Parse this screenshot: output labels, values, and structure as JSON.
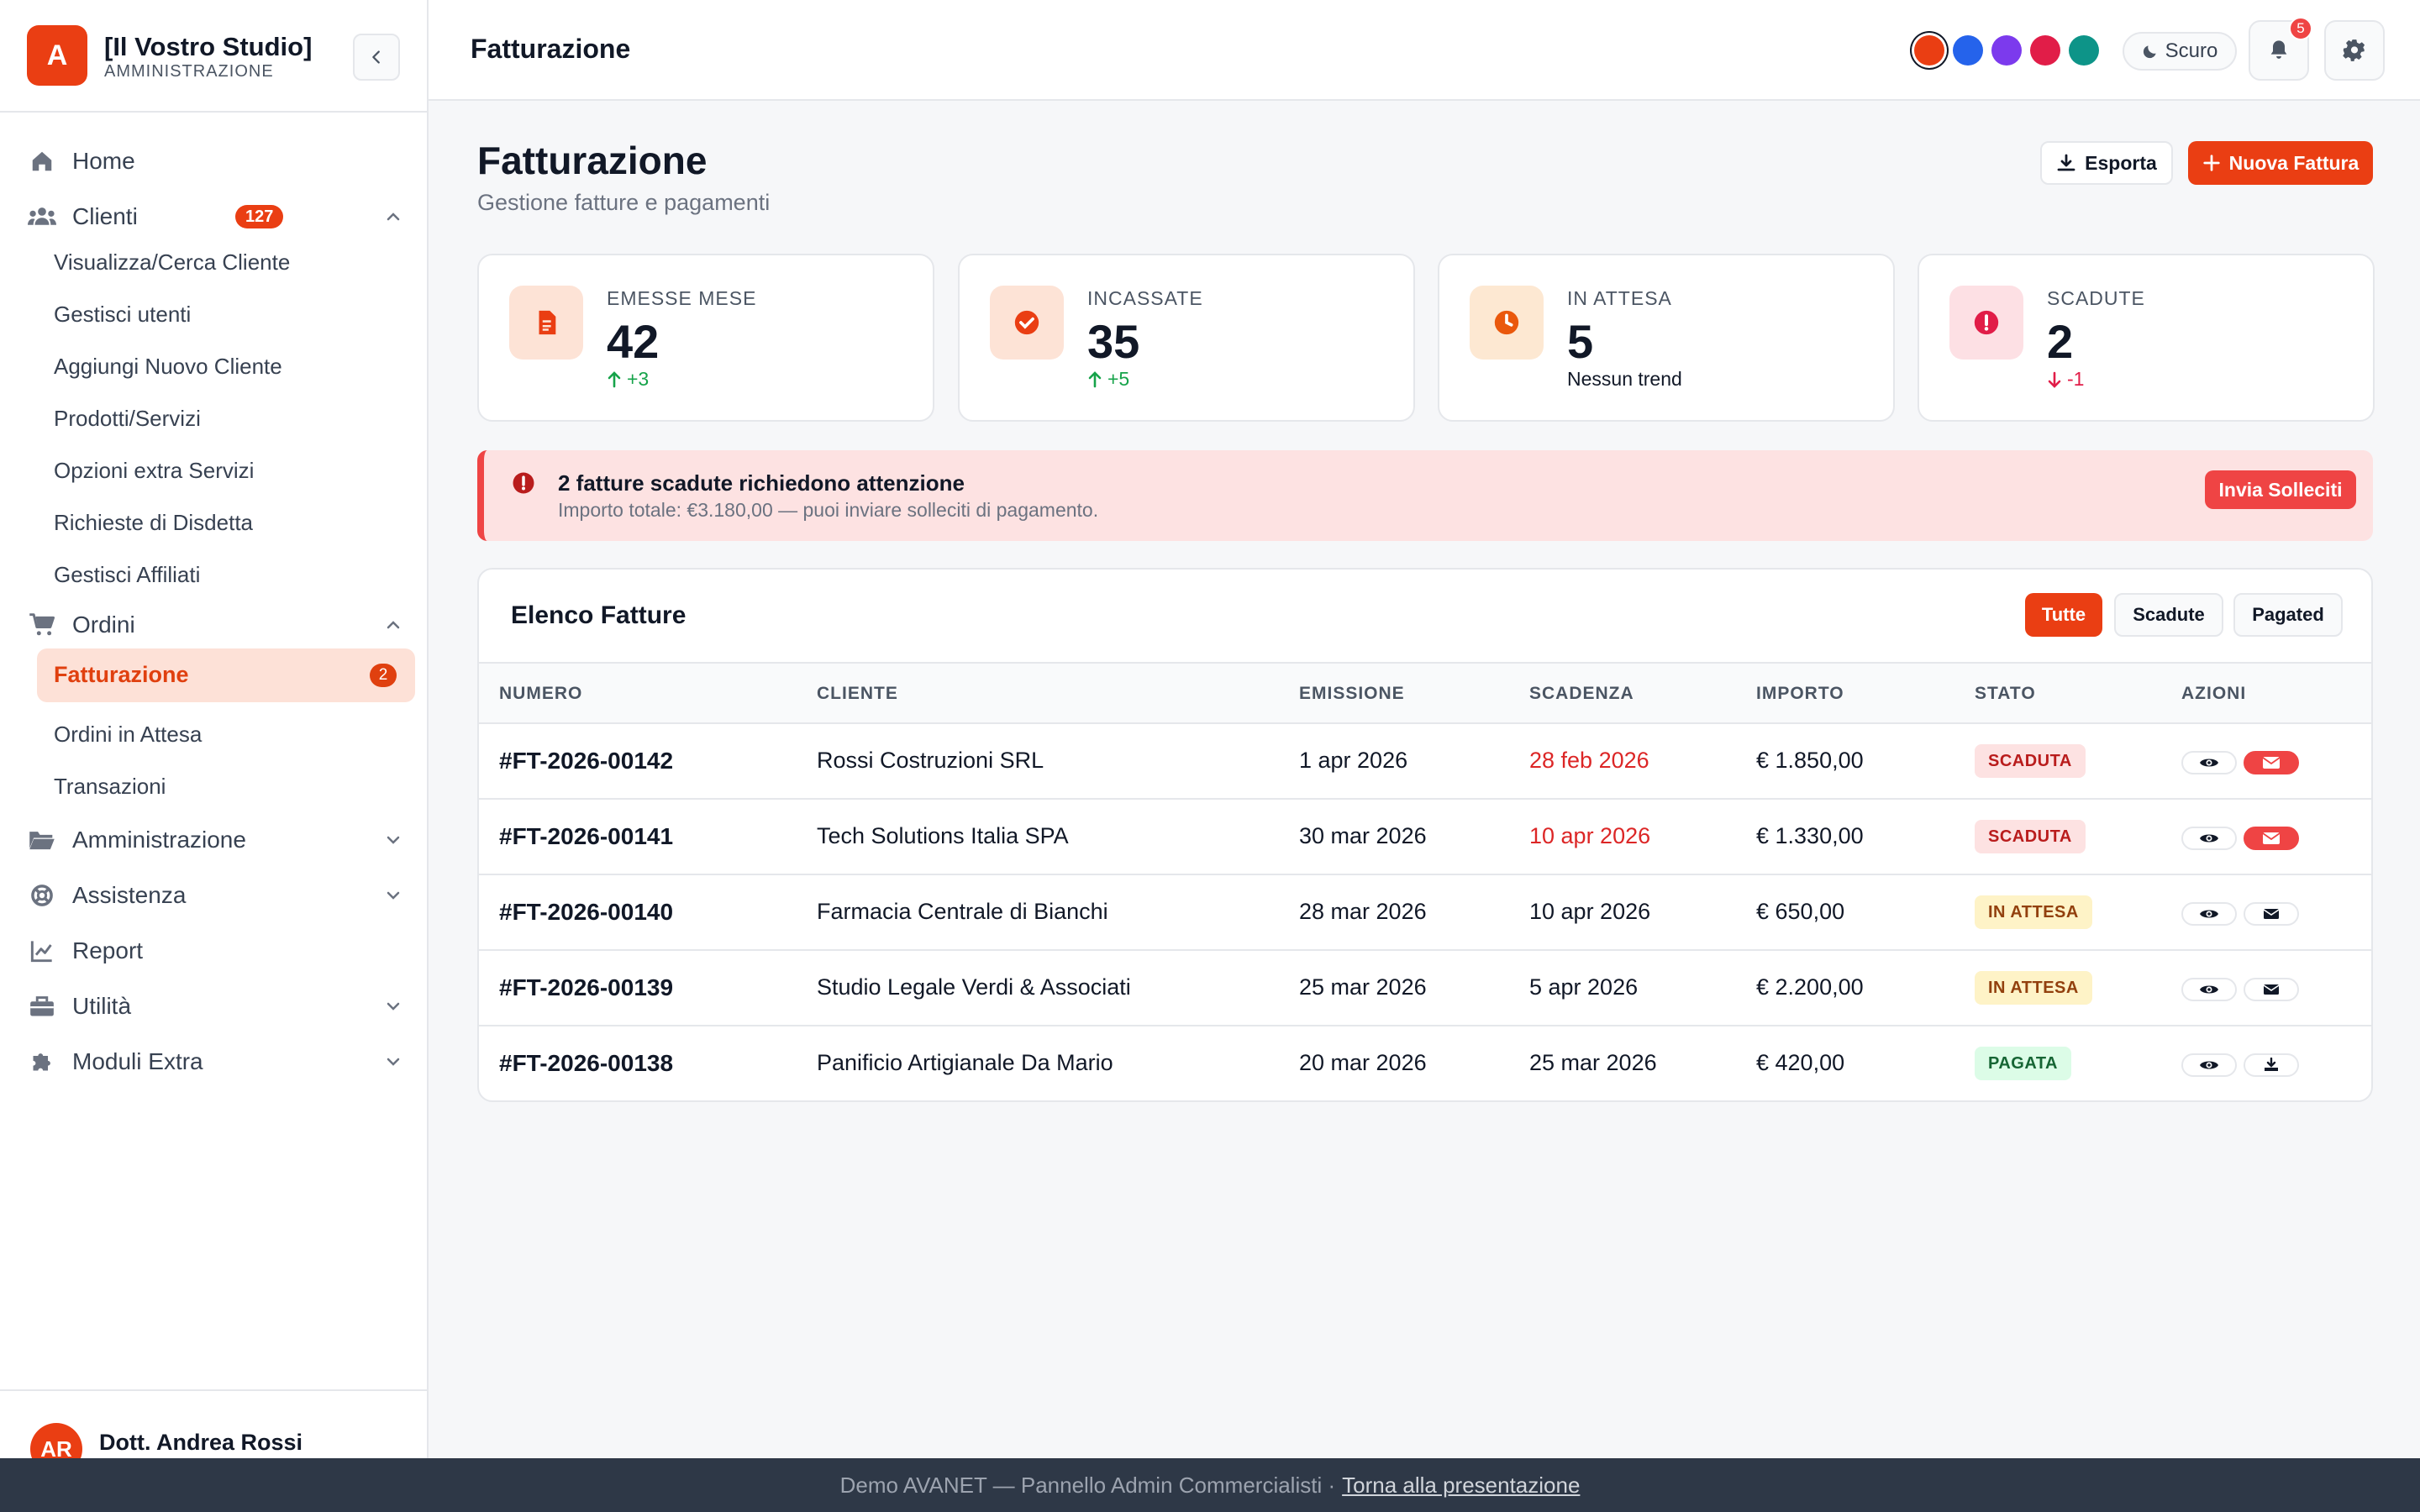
{
  "brand": {
    "logo_letter": "A",
    "name": "[Il Vostro Studio]",
    "subtitle": "AMMINISTRAZIONE"
  },
  "sidebar": {
    "items": [
      {
        "label": "Home",
        "icon": "home-icon"
      },
      {
        "label": "Clienti",
        "icon": "users-icon",
        "badge": "127",
        "expanded": true
      },
      {
        "label": "Ordini",
        "icon": "cart-icon",
        "expanded": true
      },
      {
        "label": "Amministrazione",
        "icon": "folder-icon"
      },
      {
        "label": "Assistenza",
        "icon": "lifebuoy-icon"
      },
      {
        "label": "Report",
        "icon": "chart-line-icon"
      },
      {
        "label": "Utilità",
        "icon": "toolbox-icon"
      },
      {
        "label": "Moduli Extra",
        "icon": "puzzle-icon"
      }
    ],
    "clienti_sub": [
      "Visualizza/Cerca Cliente",
      "Gestisci utenti",
      "Aggiungi Nuovo Cliente",
      "Prodotti/Servizi",
      "Opzioni extra Servizi",
      "Richieste di Disdetta",
      "Gestisci Affiliati"
    ],
    "ordini_sub": [
      {
        "label": "Fatturazione",
        "count": "2",
        "active": true
      },
      {
        "label": "Ordini in Attesa"
      },
      {
        "label": "Transazioni"
      }
    ]
  },
  "user": {
    "initials": "AR",
    "name": "Dott. Andrea Rossi"
  },
  "header": {
    "title": "Fatturazione",
    "theme_colors": [
      "#ea3e13",
      "#2563eb",
      "#7c3aed",
      "#e11d48",
      "#0d9488"
    ],
    "theme_toggle": "Scuro",
    "notifications": "5"
  },
  "page": {
    "title": "Fatturazione",
    "subtitle": "Gestione fatture e pagamenti",
    "export_label": "Esporta",
    "new_label": "Nuova Fattura"
  },
  "stats": [
    {
      "label": "EMESSE MESE",
      "value": "42",
      "trend": "+3",
      "dir": "up",
      "icon": "document-icon",
      "color": "#ea3e13"
    },
    {
      "label": "INCASSATE",
      "value": "35",
      "trend": "+5",
      "dir": "up",
      "icon": "check-circle-icon",
      "color": "#ea3e13"
    },
    {
      "label": "IN ATTESA",
      "value": "5",
      "trend": "Nessun trend",
      "dir": "none",
      "icon": "clock-icon",
      "color": "#ea580c"
    },
    {
      "label": "SCADUTE",
      "value": "2",
      "trend": "-1",
      "dir": "down",
      "icon": "alert-circle-icon",
      "color": "#e11d48"
    }
  ],
  "alert": {
    "title": "2 fatture scadute richiedono attenzione",
    "text": "Importo totale: €3.180,00 — puoi inviare solleciti di pagamento.",
    "button": "Invia Solleciti"
  },
  "table": {
    "title": "Elenco Fatture",
    "filters": [
      "Tutte",
      "Scadute",
      "Pagated"
    ],
    "active_filter": "Tutte",
    "columns": [
      "NUMERO",
      "CLIENTE",
      "EMISSIONE",
      "SCADENZA",
      "IMPORTO",
      "STATO",
      "AZIONI"
    ],
    "rows": [
      {
        "numero": "#FT-2026-00142",
        "cliente": "Rossi Costruzioni SRL",
        "emissione": "1 apr 2026",
        "scadenza": "28 feb 2026",
        "overdue": true,
        "importo": "€ 1.850,00",
        "stato": "SCADUTA",
        "action2": "mail-icon"
      },
      {
        "numero": "#FT-2026-00141",
        "cliente": "Tech Solutions Italia SPA",
        "emissione": "30 mar 2026",
        "scadenza": "10 apr 2026",
        "overdue": true,
        "importo": "€ 1.330,00",
        "stato": "SCADUTA",
        "action2": "mail-icon"
      },
      {
        "numero": "#FT-2026-00140",
        "cliente": "Farmacia Centrale di Bianchi",
        "emissione": "28 mar 2026",
        "scadenza": "10 apr 2026",
        "overdue": false,
        "importo": "€ 650,00",
        "stato": "IN ATTESA",
        "action2": "mail-icon"
      },
      {
        "numero": "#FT-2026-00139",
        "cliente": "Studio Legale Verdi & Associati",
        "emissione": "25 mar 2026",
        "scadenza": "5 apr 2026",
        "overdue": false,
        "importo": "€ 2.200,00",
        "stato": "IN ATTESA",
        "action2": "mail-icon"
      },
      {
        "numero": "#FT-2026-00138",
        "cliente": "Panificio Artigianale Da Mario",
        "emissione": "20 mar 2026",
        "scadenza": "25 mar 2026",
        "overdue": false,
        "importo": "€ 420,00",
        "stato": "PAGATA",
        "action2": "download-icon"
      }
    ]
  },
  "footer": {
    "text": "Demo AVANET — Pannello Admin Commercialisti ·",
    "link": "Torna alla presentazione"
  }
}
